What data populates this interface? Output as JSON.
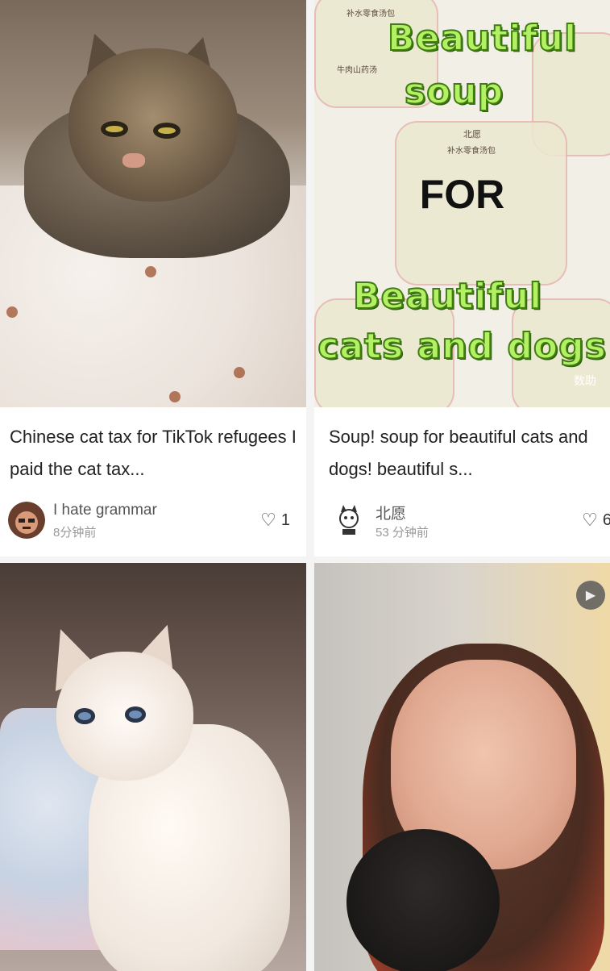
{
  "feed": [
    {
      "title": "Chinese cat tax for TikTok refugees I paid the cat tax...",
      "author": "I hate grammar",
      "time": "8分钟前",
      "likes": "1"
    },
    {
      "title": "Soup! soup for beautiful cats and dogs! beautiful s...",
      "author": "北愿",
      "time": "53 分钟前",
      "likes": "6",
      "poster": {
        "line1": "Beautiful",
        "line2": "soup",
        "line3": "FOR",
        "line4": "Beautiful",
        "line5": "cats and dogs",
        "pouch_text": "补水零食汤包",
        "pouch_brand": "北愿",
        "pouch_text2": "牛肉山药汤",
        "corner_text": "数助"
      }
    },
    {
      "title": "",
      "author": "",
      "time": "",
      "likes": ""
    },
    {
      "title": "",
      "author": "",
      "time": "",
      "likes": "",
      "play_icon": "play-icon"
    }
  ],
  "icons": {
    "heart": "heart-outline-icon",
    "play": "play-icon"
  },
  "colors": {
    "poster_text_fill": "#b3f063",
    "poster_text_stroke": "#3f7d12",
    "page_bg": "#f4f4f4"
  }
}
